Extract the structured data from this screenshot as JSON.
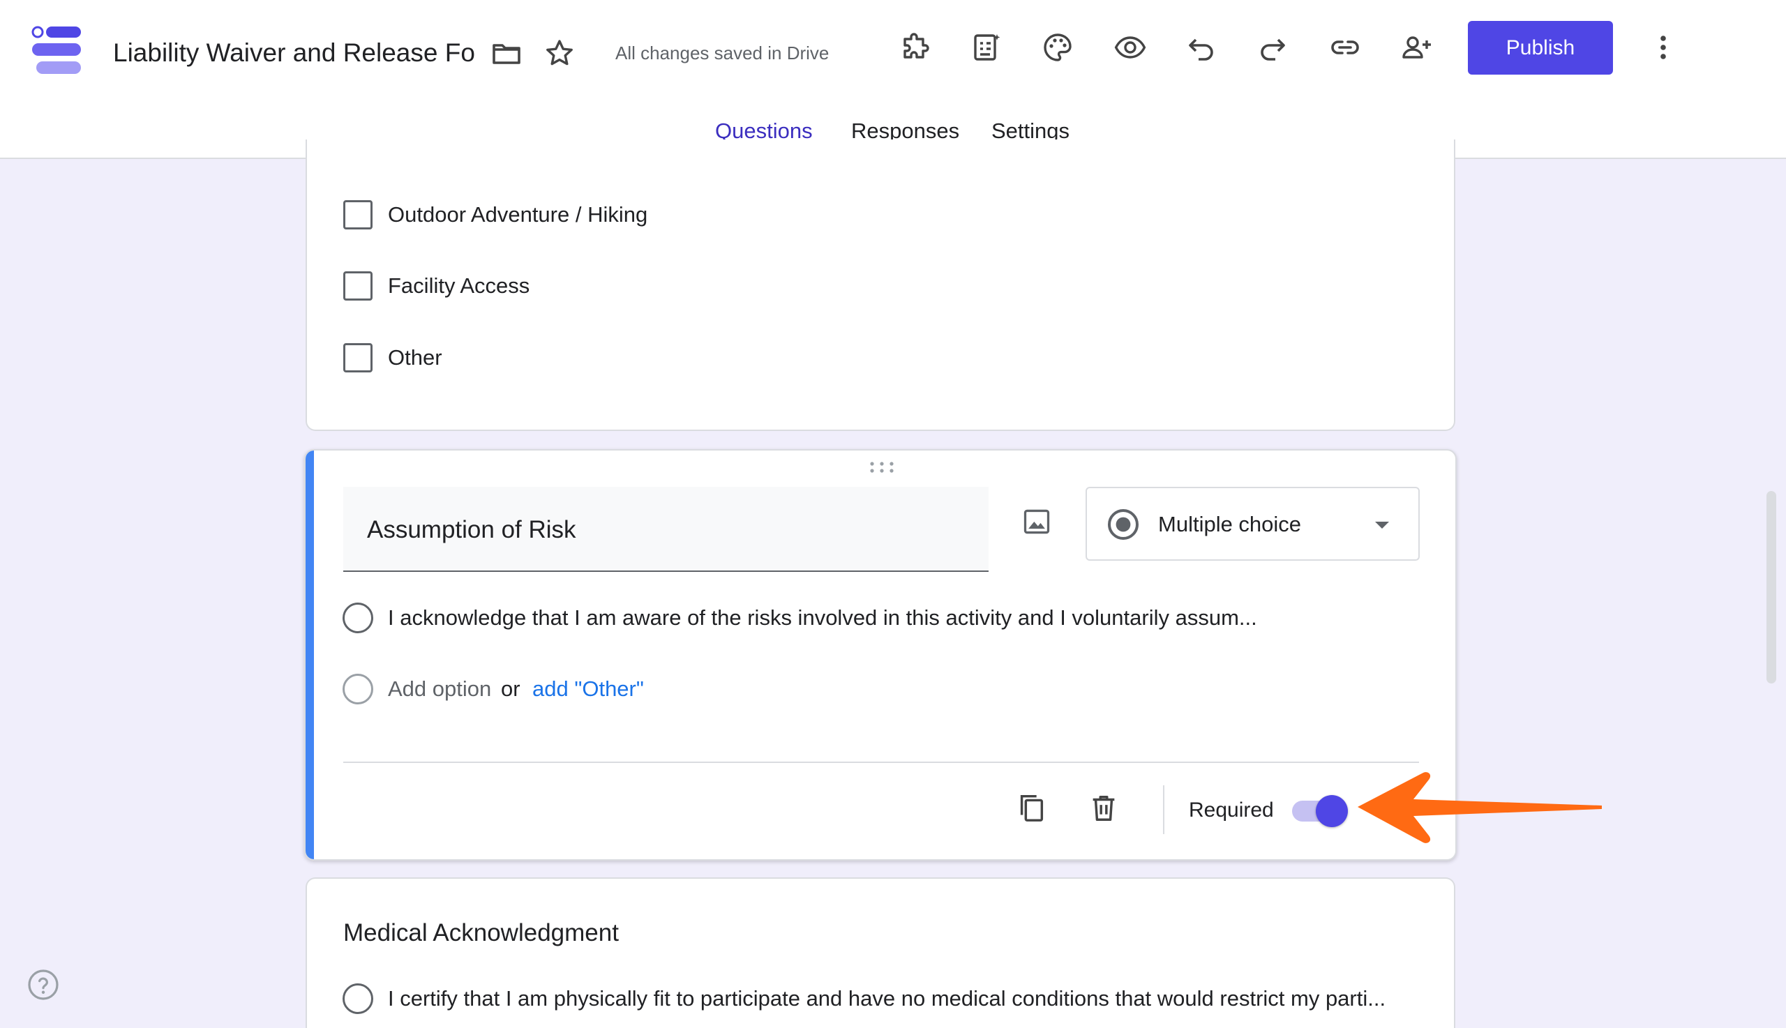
{
  "colors": {
    "accent": "#4f46e5",
    "tab_active": "#3b2ebf",
    "card_accent": "#4285f4",
    "link": "#1a73e8",
    "arrow": "#ff6a13",
    "background": "#f0eefb"
  },
  "header": {
    "title": "Liability Waiver and Release Fo",
    "save_status": "All changes saved in Drive",
    "publish_label": "Publish",
    "icons": [
      "folder-icon",
      "star-icon",
      "addon-icon",
      "ai-generate-icon",
      "palette-icon",
      "preview-icon",
      "undo-icon",
      "redo-icon",
      "link-icon",
      "add-collaborator-icon",
      "more-vert-icon"
    ]
  },
  "tabs": [
    {
      "label": "Questions",
      "active": true
    },
    {
      "label": "Responses",
      "active": false
    },
    {
      "label": "Settings",
      "active": false
    }
  ],
  "previous_question": {
    "options": [
      "Outdoor Adventure / Hiking",
      "Facility Access",
      "Other"
    ]
  },
  "active_question": {
    "title": "Assumption of Risk",
    "type": "Multiple choice",
    "options": [
      "I acknowledge that I am aware of the risks involved in this activity and I voluntarily assum..."
    ],
    "add_option": "Add option",
    "or": "or",
    "add_other": "add \"Other\"",
    "required_label": "Required",
    "required": true
  },
  "next_question": {
    "title": "Medical Acknowledgment",
    "options": [
      "I certify that I am physically fit to participate and have no medical conditions that would restrict my parti..."
    ]
  }
}
